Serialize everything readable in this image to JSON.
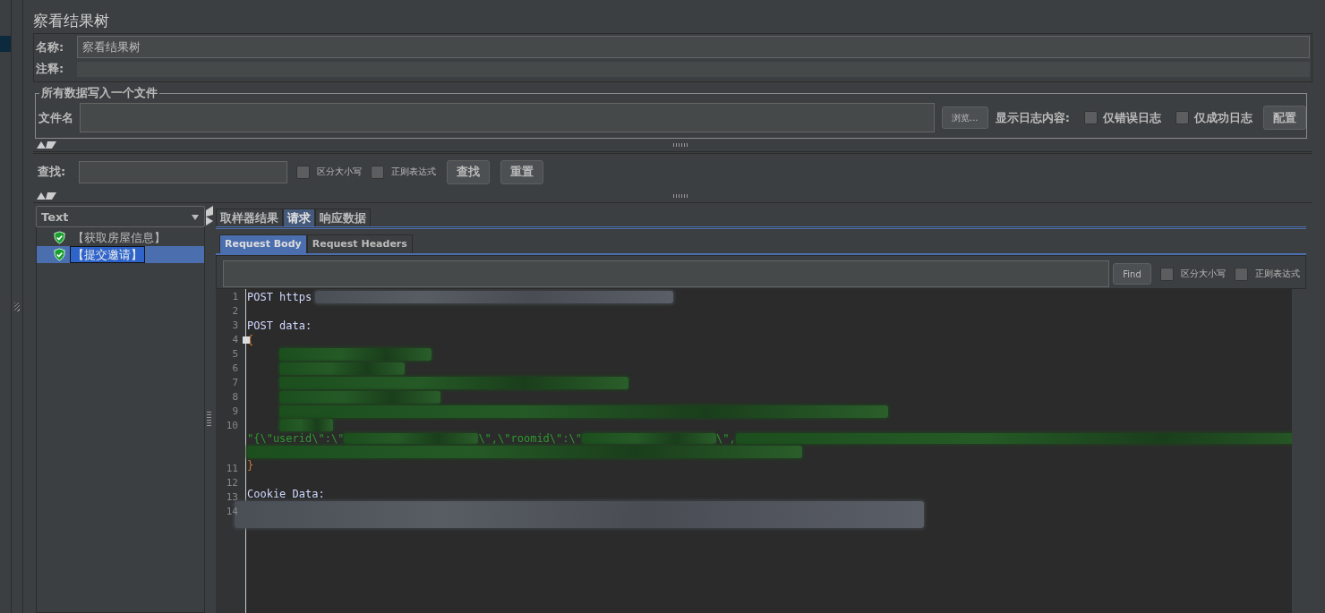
{
  "title": "察看结果树",
  "name_field": {
    "label": "名称:",
    "value": "察看结果树"
  },
  "comment_field": {
    "label": "注释:"
  },
  "file_group": {
    "legend": "所有数据写入一个文件",
    "file_label": "文件名",
    "browse_button": "浏览...",
    "log_label": "显示日志内容:",
    "checkboxes": [
      {
        "label": "仅错误日志",
        "checked": false
      },
      {
        "label": "仅成功日志",
        "checked": false
      }
    ],
    "config_button": "配置"
  },
  "search": {
    "label": "查找:",
    "checkboxes": [
      {
        "label": "区分大小写",
        "checked": false
      },
      {
        "label": "正则表达式",
        "checked": false
      }
    ],
    "buttons": [
      "查找",
      "重置"
    ]
  },
  "renderer": {
    "value": "Text"
  },
  "tree": [
    {
      "label": "【获取房屋信息】",
      "selected": false
    },
    {
      "label": "【提交邀请】",
      "selected": true
    }
  ],
  "tabs": [
    {
      "label": "取样器结果",
      "selected": false
    },
    {
      "label": "请求",
      "selected": true
    },
    {
      "label": "响应数据",
      "selected": false
    }
  ],
  "subtabs": [
    {
      "label": "Request Body",
      "selected": true
    },
    {
      "label": "Request Headers",
      "selected": false
    }
  ],
  "find": {
    "button": "Find",
    "checkboxes": [
      {
        "label": "区分大小写",
        "checked": false
      },
      {
        "label": "正则表达式",
        "checked": false
      }
    ]
  },
  "code_lines": [
    {
      "number": "1",
      "kind": "plain",
      "segments": [
        "POST https"
      ],
      "redacted": true
    },
    {
      "number": "2",
      "kind": "plain",
      "redacted": false
    },
    {
      "number": "3",
      "kind": "plain",
      "segments": [
        "POST data:"
      ],
      "redacted": false
    },
    {
      "number": "4",
      "kind": "brace",
      "segments": [
        "{"
      ],
      "redacted": false,
      "foldable": true
    },
    {
      "number": "5",
      "kind": "string",
      "redacted": true
    },
    {
      "number": "6",
      "kind": "string",
      "redacted": true
    },
    {
      "number": "7",
      "kind": "string",
      "redacted": true
    },
    {
      "number": "8",
      "kind": "string",
      "redacted": true
    },
    {
      "number": "9",
      "kind": "string",
      "redacted": true
    },
    {
      "number": "10",
      "kind": "string",
      "segments": [
        "\"{\\\"userid\\\":\\\"",
        "\\\",\\\"roomid\\\":\\\"",
        "\\\","
      ],
      "redacted": true
    },
    {
      "number": "11",
      "kind": "brace",
      "segments": [
        "}"
      ],
      "redacted": false
    },
    {
      "number": "12",
      "kind": "plain",
      "redacted": false
    },
    {
      "number": "13",
      "kind": "plain",
      "segments": [
        "Cookie Data:"
      ],
      "redacted": false
    },
    {
      "number": "14",
      "kind": "plain",
      "redacted": true
    }
  ]
}
